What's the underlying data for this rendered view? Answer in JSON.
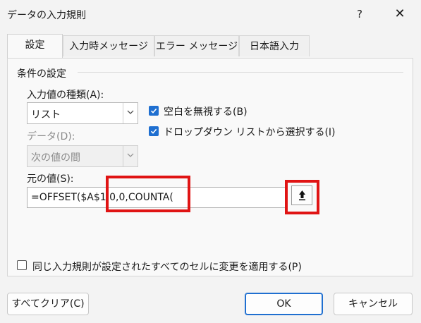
{
  "dialog": {
    "title": "データの入力規則",
    "help": "?",
    "close": "✕"
  },
  "tabs": [
    {
      "label": "設定"
    },
    {
      "label": "入力時メッセージ"
    },
    {
      "label": "エラー メッセージ"
    },
    {
      "label": "日本語入力"
    }
  ],
  "conditions": {
    "group_label": "条件の設定",
    "allow_label": "入力値の種類(A):",
    "allow_value": "リスト",
    "data_label": "データ(D):",
    "data_value": "次の値の間",
    "ignore_blank_label": "空白を無視する(B)",
    "ignore_blank_checked": true,
    "dropdown_label": "ドロップダウン リストから選択する(I)",
    "dropdown_checked": true,
    "source_label": "元の値(S):",
    "source_value": "=OFFSET($A$1,0,0,COUNTA("
  },
  "apply_all": {
    "label": "同じ入力規則が設定されたすべてのセルに変更を適用する(P)",
    "checked": false
  },
  "buttons": {
    "clear_all": "すべてクリア(C)",
    "ok": "OK",
    "cancel": "キャンセル"
  },
  "colors": {
    "accent": "#1f6fd0",
    "highlight": "#e01414"
  }
}
